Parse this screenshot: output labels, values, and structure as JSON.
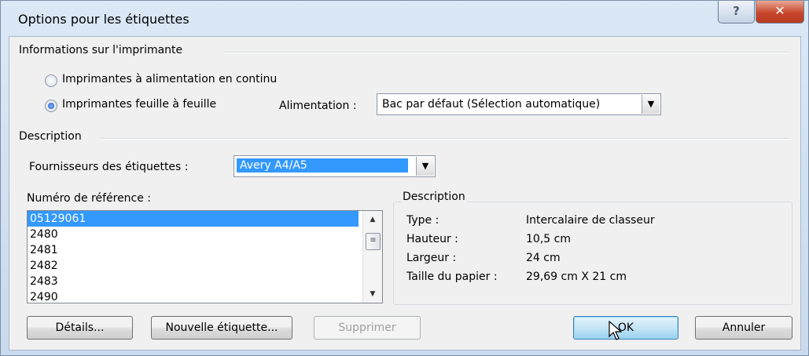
{
  "window": {
    "title": "Options pour les étiquettes",
    "help_glyph": "?",
    "close_glyph": "✕"
  },
  "printer_group": {
    "label": "Informations sur l'imprimante",
    "radio_continuous": {
      "label": "Imprimantes à alimentation en continu",
      "checked": false
    },
    "radio_sheet": {
      "label": "Imprimantes feuille à feuille",
      "checked": true
    },
    "feed_label": "Alimentation :",
    "feed_value": "Bac par défaut (Sélection automatique)"
  },
  "description_group": {
    "label": "Description",
    "vendor_label": "Fournisseurs des étiquettes :",
    "vendor_value": "Avery A4/A5"
  },
  "reference": {
    "label": "Numéro de référence :",
    "items": [
      "05129061",
      "2480",
      "2481",
      "2482",
      "2483",
      "2490"
    ],
    "selected_index": 0
  },
  "details": {
    "title": "Description",
    "type_label": "Type :",
    "type_value": "Intercalaire de classeur",
    "height_label": "Hauteur :",
    "height_value": "10,5 cm",
    "width_label": "Largeur :",
    "width_value": "24 cm",
    "paper_label": "Taille du papier :",
    "paper_value": "29,69 cm X 21 cm"
  },
  "buttons": {
    "details": "Détails...",
    "new_label": "Nouvelle étiquette...",
    "delete": "Supprimer",
    "ok": "OK",
    "cancel": "Annuler"
  },
  "colors": {
    "selection": "#3399ff",
    "close_button": "#c7452b",
    "default_button": "#3c7fb1"
  }
}
